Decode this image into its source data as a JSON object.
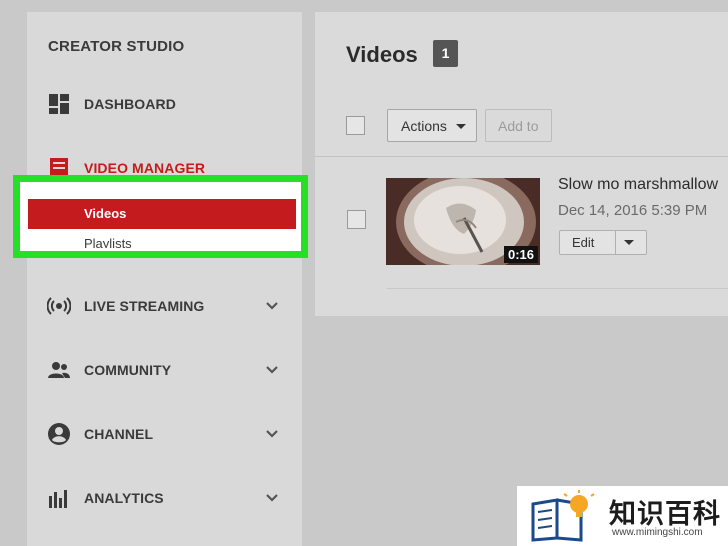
{
  "sidebar": {
    "title": "CREATOR STUDIO",
    "items": [
      {
        "label": "DASHBOARD",
        "icon": "dashboard-icon"
      },
      {
        "label": "VIDEO MANAGER",
        "icon": "video-manager-icon",
        "color": "#c41b1e"
      },
      {
        "label": "LIVE STREAMING",
        "icon": "live-streaming-icon"
      },
      {
        "label": "COMMUNITY",
        "icon": "community-icon"
      },
      {
        "label": "CHANNEL",
        "icon": "channel-icon"
      },
      {
        "label": "ANALYTICS",
        "icon": "analytics-icon"
      }
    ],
    "sub_items": [
      "Videos",
      "Playlists"
    ]
  },
  "main": {
    "title": "Videos",
    "count": "1",
    "actions_label": "Actions",
    "add_to_label": "Add to",
    "video": {
      "title": "Slow mo marshmallow",
      "date": "Dec 14, 2016 5:39 PM",
      "duration": "0:16",
      "edit_label": "Edit"
    }
  },
  "watermark": {
    "cn_text": "知识百科",
    "url": "www.mimingshi.com"
  },
  "colors": {
    "accent_red": "#c41b1e",
    "highlight_green": "#25e025"
  }
}
